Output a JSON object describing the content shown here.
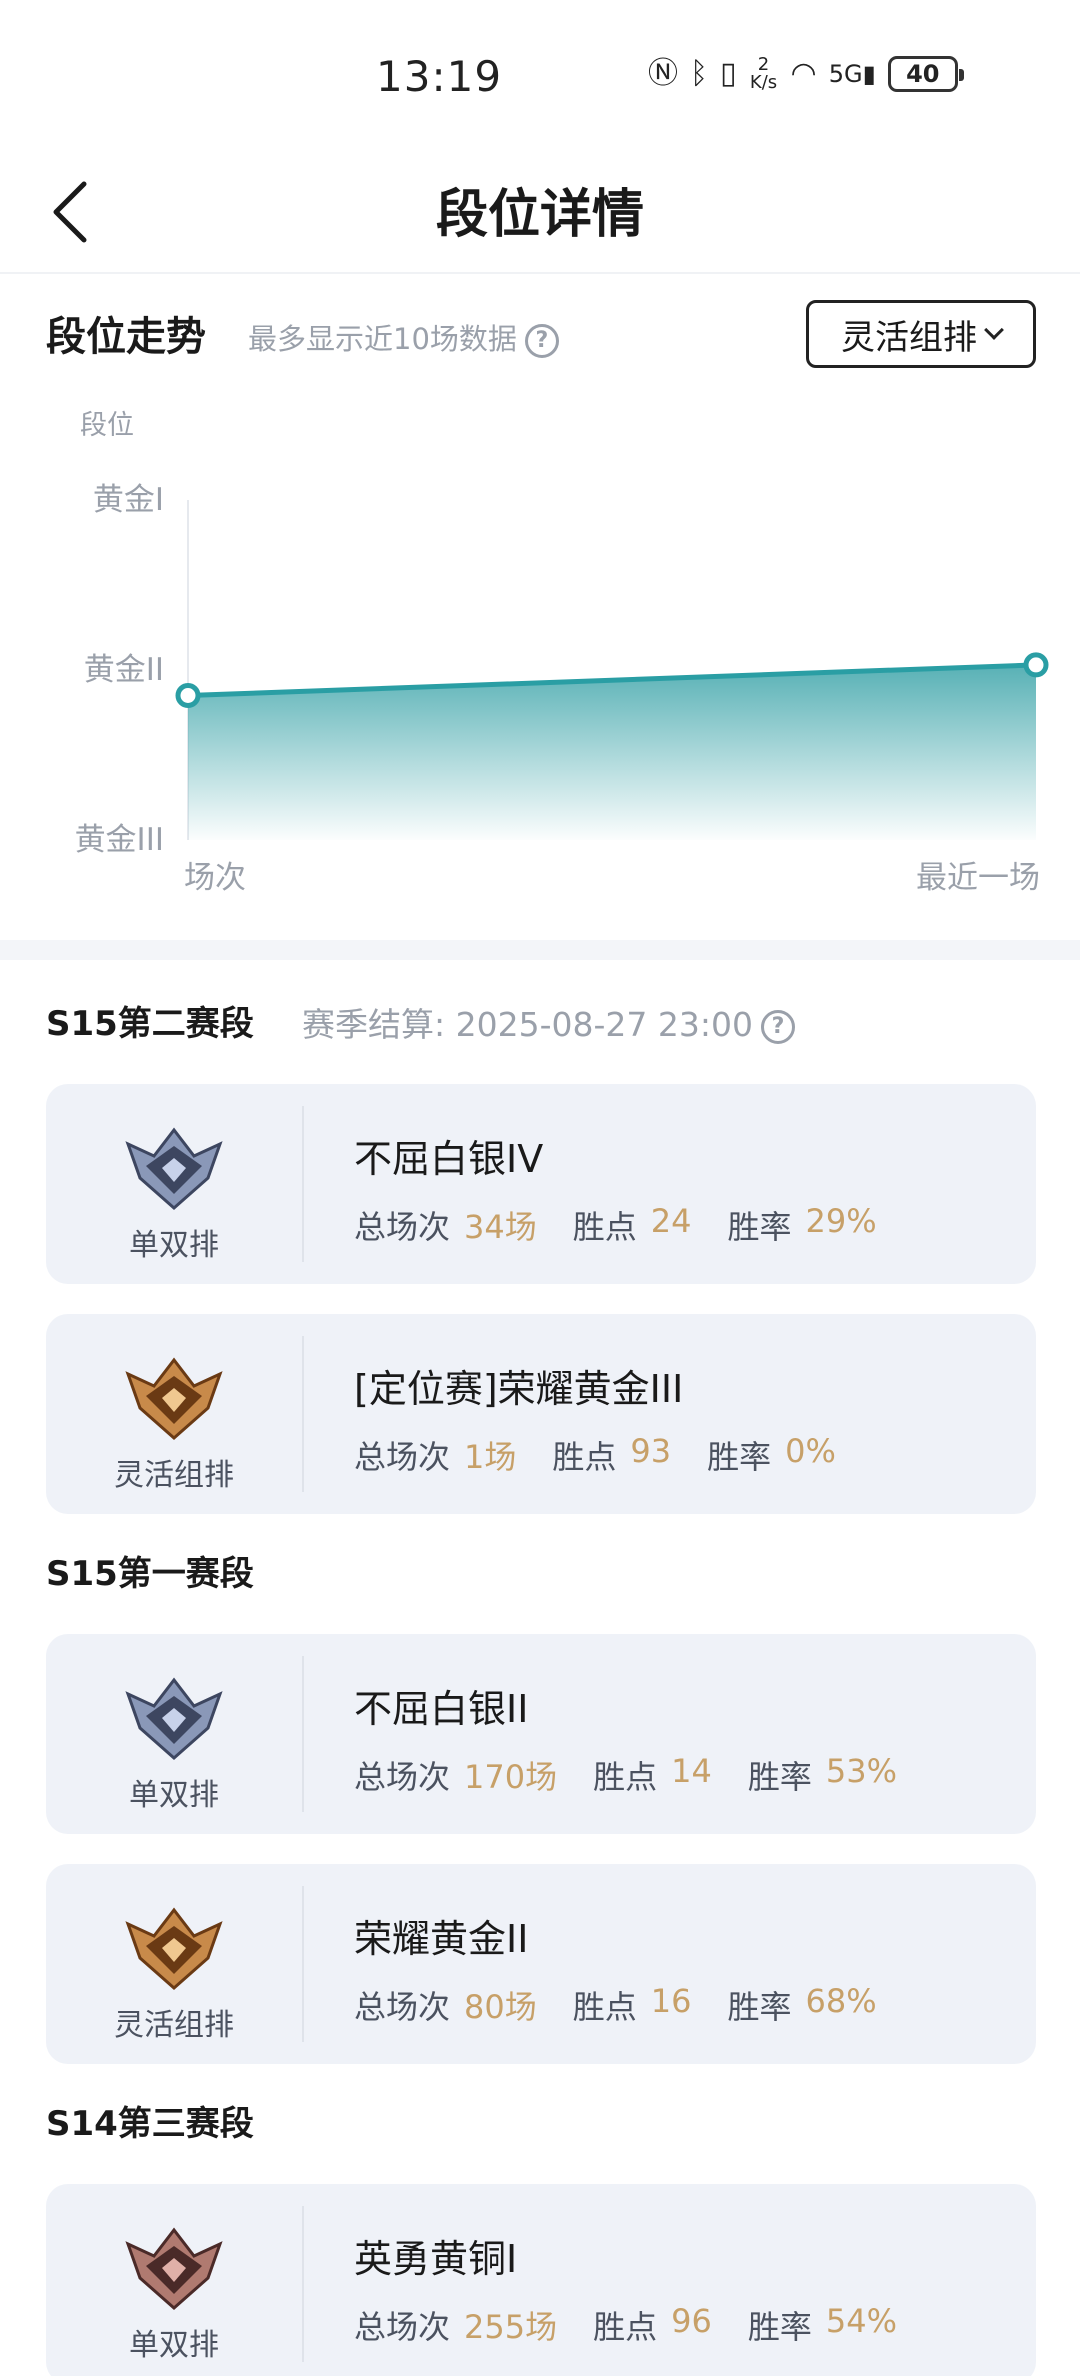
{
  "status": {
    "time": "13:19",
    "net_speed": "2\nK/s",
    "battery": "40"
  },
  "header": {
    "title": "段位详情"
  },
  "trend": {
    "title": "段位走势",
    "subtitle": "最多显示近10场数据",
    "mode_selected": "灵活组排"
  },
  "chart_data": {
    "type": "area",
    "ylabel": "段位",
    "y_ticks": [
      "黄金I",
      "黄金II",
      "黄金III"
    ],
    "x_ticks": [
      "场次",
      "最近一场"
    ],
    "points": [
      {
        "x": "场次",
        "y": 2.15
      },
      {
        "x": "最近一场",
        "y": 1.97
      }
    ],
    "ylim": [
      1,
      3
    ],
    "color": "#2a9ea4",
    "grid": false
  },
  "seasons": [
    {
      "title": "S15第二赛段",
      "settle": "赛季结算: 2025-08-27 23:00",
      "cards": [
        {
          "mode": "单双排",
          "rank": "不屈白银IV",
          "games_label": "总场次",
          "games": "34场",
          "points_label": "胜点",
          "points": "24",
          "rate_label": "胜率",
          "rate": "29%",
          "badge": "silver"
        },
        {
          "mode": "灵活组排",
          "rank": "[定位赛]荣耀黄金III",
          "games_label": "总场次",
          "games": "1场",
          "points_label": "胜点",
          "points": "93",
          "rate_label": "胜率",
          "rate": "0%",
          "badge": "gold"
        }
      ]
    },
    {
      "title": "S15第一赛段",
      "settle": "",
      "cards": [
        {
          "mode": "单双排",
          "rank": "不屈白银II",
          "games_label": "总场次",
          "games": "170场",
          "points_label": "胜点",
          "points": "14",
          "rate_label": "胜率",
          "rate": "53%",
          "badge": "silver"
        },
        {
          "mode": "灵活组排",
          "rank": "荣耀黄金II",
          "games_label": "总场次",
          "games": "80场",
          "points_label": "胜点",
          "points": "16",
          "rate_label": "胜率",
          "rate": "68%",
          "badge": "gold"
        }
      ]
    },
    {
      "title": "S14第三赛段",
      "settle": "",
      "cards": [
        {
          "mode": "单双排",
          "rank": "英勇黄铜I",
          "games_label": "总场次",
          "games": "255场",
          "points_label": "胜点",
          "points": "96",
          "rate_label": "胜率",
          "rate": "54%",
          "badge": "bronze"
        }
      ]
    }
  ],
  "icons": {
    "back": "chevron-left-icon",
    "help": "question-circle-icon",
    "dropdown": "chevron-down-icon"
  }
}
